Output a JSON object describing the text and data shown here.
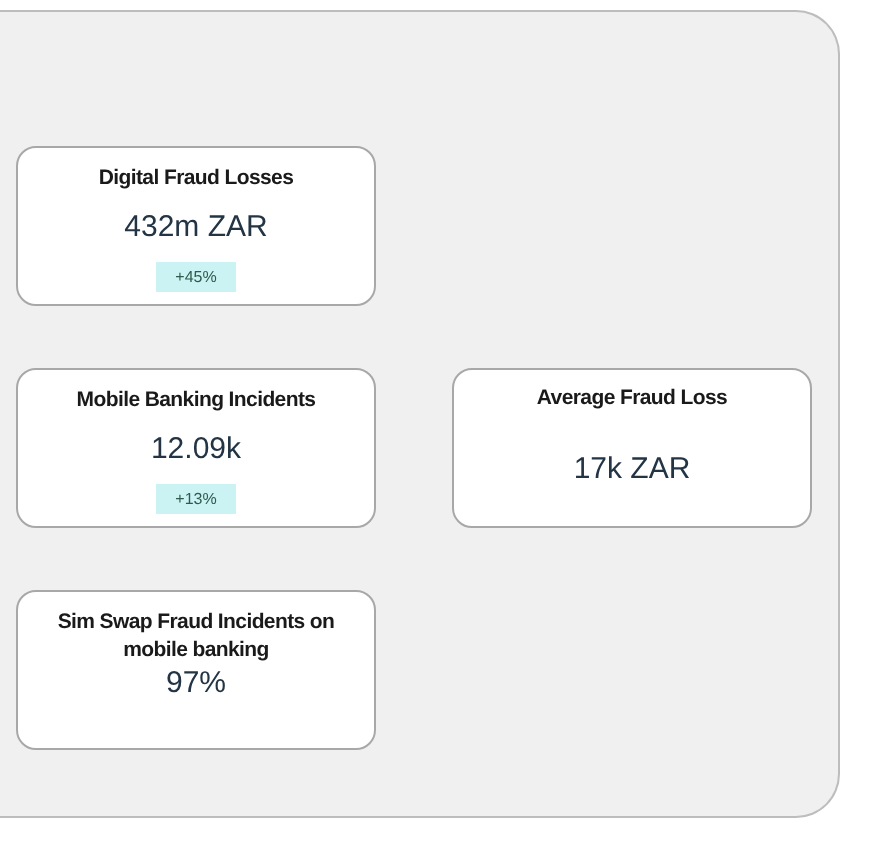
{
  "cards": [
    {
      "title": "Digital Fraud Losses",
      "value": "432m ZAR",
      "change": "+45%"
    },
    {
      "title": "Mobile Banking Incidents",
      "value": "12.09k",
      "change": "+13%"
    },
    {
      "title": "Average Fraud Loss",
      "value": "17k ZAR"
    },
    {
      "title": "Sim Swap Fraud Incidents on mobile banking",
      "value": "97%"
    }
  ]
}
